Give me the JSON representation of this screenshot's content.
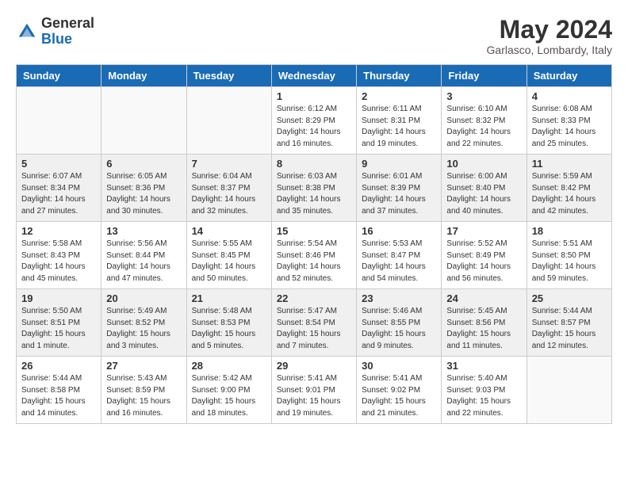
{
  "logo": {
    "general": "General",
    "blue": "Blue"
  },
  "header": {
    "month_year": "May 2024",
    "location": "Garlasco, Lombardy, Italy"
  },
  "days_of_week": [
    "Sunday",
    "Monday",
    "Tuesday",
    "Wednesday",
    "Thursday",
    "Friday",
    "Saturday"
  ],
  "weeks": [
    {
      "shaded": false,
      "days": [
        {
          "num": "",
          "info": ""
        },
        {
          "num": "",
          "info": ""
        },
        {
          "num": "",
          "info": ""
        },
        {
          "num": "1",
          "info": "Sunrise: 6:12 AM\nSunset: 8:29 PM\nDaylight: 14 hours\nand 16 minutes."
        },
        {
          "num": "2",
          "info": "Sunrise: 6:11 AM\nSunset: 8:31 PM\nDaylight: 14 hours\nand 19 minutes."
        },
        {
          "num": "3",
          "info": "Sunrise: 6:10 AM\nSunset: 8:32 PM\nDaylight: 14 hours\nand 22 minutes."
        },
        {
          "num": "4",
          "info": "Sunrise: 6:08 AM\nSunset: 8:33 PM\nDaylight: 14 hours\nand 25 minutes."
        }
      ]
    },
    {
      "shaded": true,
      "days": [
        {
          "num": "5",
          "info": "Sunrise: 6:07 AM\nSunset: 8:34 PM\nDaylight: 14 hours\nand 27 minutes."
        },
        {
          "num": "6",
          "info": "Sunrise: 6:05 AM\nSunset: 8:36 PM\nDaylight: 14 hours\nand 30 minutes."
        },
        {
          "num": "7",
          "info": "Sunrise: 6:04 AM\nSunset: 8:37 PM\nDaylight: 14 hours\nand 32 minutes."
        },
        {
          "num": "8",
          "info": "Sunrise: 6:03 AM\nSunset: 8:38 PM\nDaylight: 14 hours\nand 35 minutes."
        },
        {
          "num": "9",
          "info": "Sunrise: 6:01 AM\nSunset: 8:39 PM\nDaylight: 14 hours\nand 37 minutes."
        },
        {
          "num": "10",
          "info": "Sunrise: 6:00 AM\nSunset: 8:40 PM\nDaylight: 14 hours\nand 40 minutes."
        },
        {
          "num": "11",
          "info": "Sunrise: 5:59 AM\nSunset: 8:42 PM\nDaylight: 14 hours\nand 42 minutes."
        }
      ]
    },
    {
      "shaded": false,
      "days": [
        {
          "num": "12",
          "info": "Sunrise: 5:58 AM\nSunset: 8:43 PM\nDaylight: 14 hours\nand 45 minutes."
        },
        {
          "num": "13",
          "info": "Sunrise: 5:56 AM\nSunset: 8:44 PM\nDaylight: 14 hours\nand 47 minutes."
        },
        {
          "num": "14",
          "info": "Sunrise: 5:55 AM\nSunset: 8:45 PM\nDaylight: 14 hours\nand 50 minutes."
        },
        {
          "num": "15",
          "info": "Sunrise: 5:54 AM\nSunset: 8:46 PM\nDaylight: 14 hours\nand 52 minutes."
        },
        {
          "num": "16",
          "info": "Sunrise: 5:53 AM\nSunset: 8:47 PM\nDaylight: 14 hours\nand 54 minutes."
        },
        {
          "num": "17",
          "info": "Sunrise: 5:52 AM\nSunset: 8:49 PM\nDaylight: 14 hours\nand 56 minutes."
        },
        {
          "num": "18",
          "info": "Sunrise: 5:51 AM\nSunset: 8:50 PM\nDaylight: 14 hours\nand 59 minutes."
        }
      ]
    },
    {
      "shaded": true,
      "days": [
        {
          "num": "19",
          "info": "Sunrise: 5:50 AM\nSunset: 8:51 PM\nDaylight: 15 hours\nand 1 minute."
        },
        {
          "num": "20",
          "info": "Sunrise: 5:49 AM\nSunset: 8:52 PM\nDaylight: 15 hours\nand 3 minutes."
        },
        {
          "num": "21",
          "info": "Sunrise: 5:48 AM\nSunset: 8:53 PM\nDaylight: 15 hours\nand 5 minutes."
        },
        {
          "num": "22",
          "info": "Sunrise: 5:47 AM\nSunset: 8:54 PM\nDaylight: 15 hours\nand 7 minutes."
        },
        {
          "num": "23",
          "info": "Sunrise: 5:46 AM\nSunset: 8:55 PM\nDaylight: 15 hours\nand 9 minutes."
        },
        {
          "num": "24",
          "info": "Sunrise: 5:45 AM\nSunset: 8:56 PM\nDaylight: 15 hours\nand 11 minutes."
        },
        {
          "num": "25",
          "info": "Sunrise: 5:44 AM\nSunset: 8:57 PM\nDaylight: 15 hours\nand 12 minutes."
        }
      ]
    },
    {
      "shaded": false,
      "days": [
        {
          "num": "26",
          "info": "Sunrise: 5:44 AM\nSunset: 8:58 PM\nDaylight: 15 hours\nand 14 minutes."
        },
        {
          "num": "27",
          "info": "Sunrise: 5:43 AM\nSunset: 8:59 PM\nDaylight: 15 hours\nand 16 minutes."
        },
        {
          "num": "28",
          "info": "Sunrise: 5:42 AM\nSunset: 9:00 PM\nDaylight: 15 hours\nand 18 minutes."
        },
        {
          "num": "29",
          "info": "Sunrise: 5:41 AM\nSunset: 9:01 PM\nDaylight: 15 hours\nand 19 minutes."
        },
        {
          "num": "30",
          "info": "Sunrise: 5:41 AM\nSunset: 9:02 PM\nDaylight: 15 hours\nand 21 minutes."
        },
        {
          "num": "31",
          "info": "Sunrise: 5:40 AM\nSunset: 9:03 PM\nDaylight: 15 hours\nand 22 minutes."
        },
        {
          "num": "",
          "info": ""
        }
      ]
    }
  ]
}
